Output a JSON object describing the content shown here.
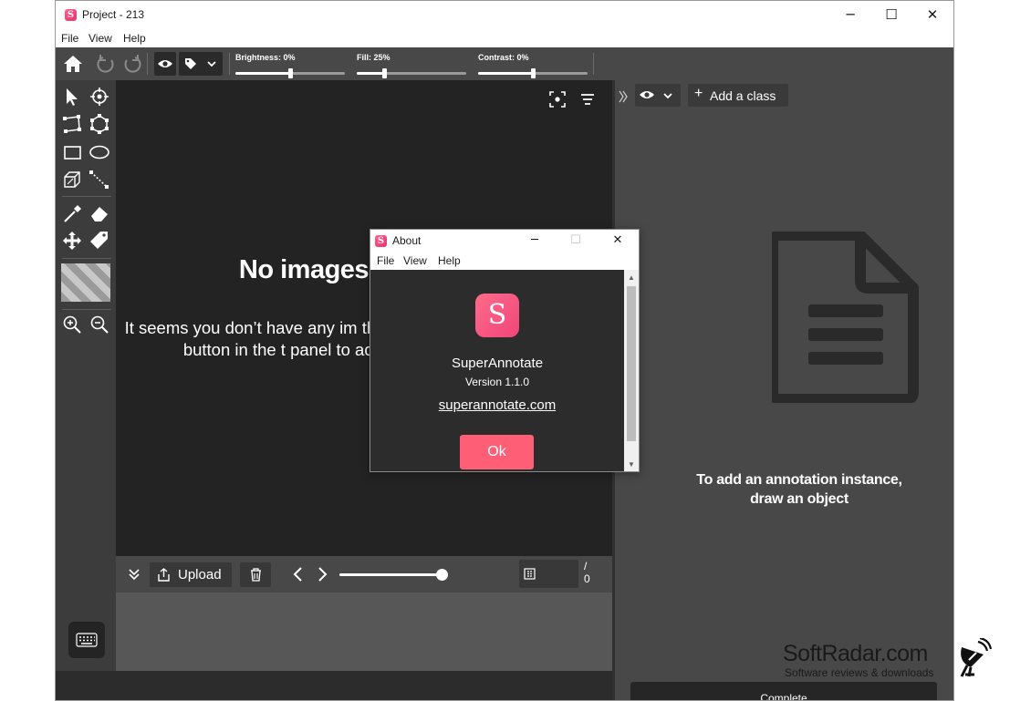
{
  "window": {
    "title": "Project - 213"
  },
  "menu": [
    "File",
    "View",
    "Help"
  ],
  "toolbar": {
    "brightness_label": "Brightness: 0%",
    "brightness_value": 0,
    "fill_label": "Fill: 25%",
    "fill_value": 25,
    "contrast_label": "Contrast: 0%",
    "contrast_value": 0
  },
  "canvas": {
    "empty_title": "No images",
    "empty_message": "It seems you don’t have any im the Choose files button in the t panel to add imag"
  },
  "bottom_bar": {
    "upload_label": "Upload",
    "page_current": "",
    "page_slash": "/",
    "page_total": "0"
  },
  "right_panel": {
    "add_class_label": "Add a class",
    "empty_text_line1": "To add an annotation instance,",
    "empty_text_line2": "draw an object",
    "complete_label": "Complete"
  },
  "about_dialog": {
    "title": "About",
    "menu": [
      "File",
      "View",
      "Help"
    ],
    "app_name": "SuperAnnotate",
    "version": "Version 1.1.0",
    "link": "superannotate.com",
    "ok_label": "Ok",
    "logo_letter": "S"
  },
  "watermark": {
    "title": "SoftRadar.com",
    "subtitle": "Software reviews & downloads"
  },
  "colors": {
    "accent": "#ff5f76",
    "logo_gradient_start": "#ff6b8a",
    "logo_gradient_end": "#f0457a",
    "dark_bg": "#232323",
    "panel_bg": "#484848"
  }
}
